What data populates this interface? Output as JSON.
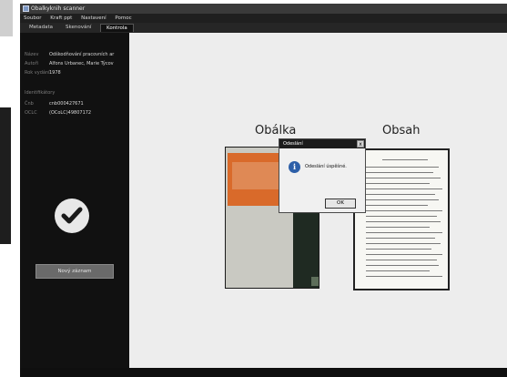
{
  "window": {
    "title": "Obalkyknih scanner"
  },
  "menu": [
    "Soubor",
    "Kraft ppt",
    "Nastavení",
    "Pomoc"
  ],
  "tabs": [
    {
      "label": "Metadata"
    },
    {
      "label": "Skenování"
    },
    {
      "label": "Kontrola",
      "active": true
    }
  ],
  "sidebar": {
    "fields": [
      {
        "key": "Název",
        "value": "Odškodňování pracovních ar"
      },
      {
        "key": "Autoři",
        "value": "Alfons Urbanec, Marie Týcov"
      },
      {
        "key": "Rok vydání",
        "value": "1978"
      }
    ],
    "identifiers_heading": "Identifikátory",
    "identifiers": [
      {
        "key": "Čnb",
        "value": "cnb000427671"
      },
      {
        "key": "OCLC",
        "value": "(OCoLC)49807172"
      }
    ],
    "new_button_label": "Nový záznam"
  },
  "content": {
    "cover_label": "Obálka",
    "contents_label": "Obsah"
  },
  "dialog": {
    "title": "Odeslání",
    "close_glyph": "x",
    "message": "Odeslání úspěšné.",
    "ok_label": "OK"
  },
  "colors": {
    "sidebar_bg": "#111111",
    "content_bg": "#ededed",
    "dialog_title_bg": "#1c1c1c",
    "info_icon": "#2d5fa8"
  }
}
